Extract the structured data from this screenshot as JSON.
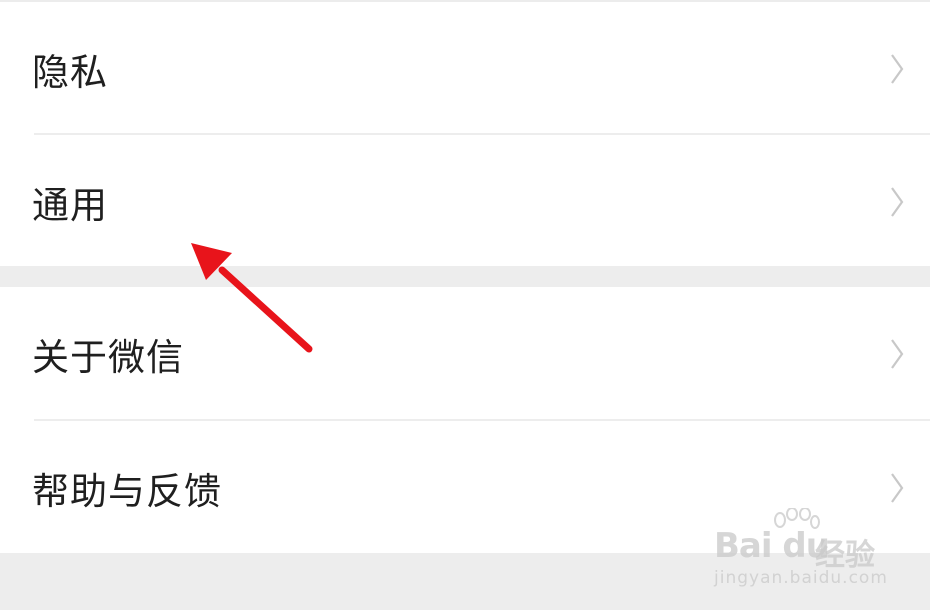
{
  "settings_list": {
    "group_1": [
      {
        "label": "隐私"
      },
      {
        "label": "通用"
      }
    ],
    "group_2": [
      {
        "label": "关于微信"
      },
      {
        "label": "帮助与反馈"
      }
    ]
  },
  "watermark": {
    "brand": "Bai du",
    "suffix": "经验",
    "url": "jingyan.baidu.com"
  },
  "colors": {
    "background": "#ededed",
    "row_bg": "#ffffff",
    "label_text": "#1f1f1f",
    "chevron": "#c8c8c8",
    "annotation_arrow": "#e8141b"
  },
  "icons": {
    "row_chevron": "chevron-right-icon",
    "annotation": "red-arrow-annotation"
  }
}
